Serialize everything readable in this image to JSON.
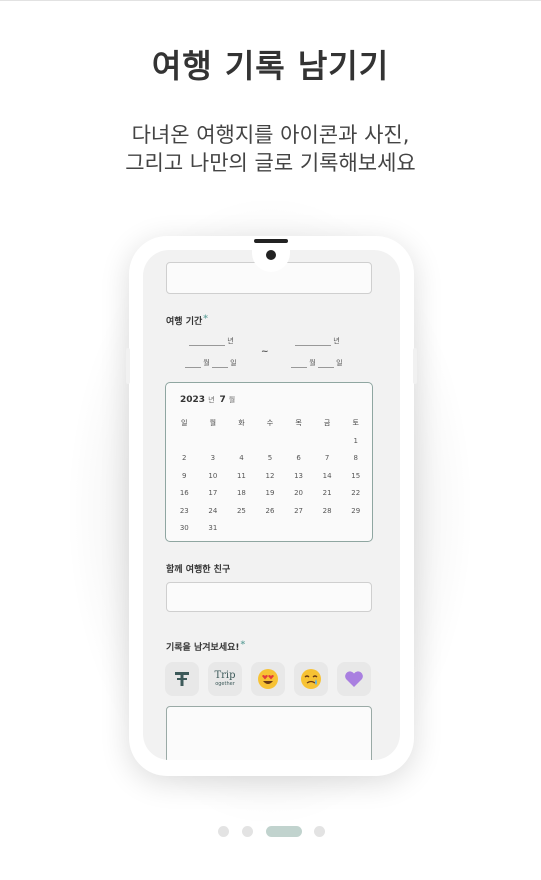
{
  "header": {
    "title": "여행 기록 남기기",
    "subtitle_line1": "다녀온 여행지를 아이콘과 사진,",
    "subtitle_line2": "그리고 나만의 글로 기록해보세요"
  },
  "form": {
    "period_label": "여행 기간",
    "required_mark": "*",
    "year_unit": "년",
    "month_unit": "월",
    "day_unit": "일",
    "range_separator": "~",
    "friends_label": "함께 여행한 친구",
    "record_label": "기록을 남겨보세요!"
  },
  "calendar": {
    "year": "2023",
    "year_unit": "년",
    "month": "7",
    "month_unit": "월",
    "weekdays": [
      "일",
      "월",
      "화",
      "수",
      "목",
      "금",
      "토"
    ],
    "days": [
      "",
      "",
      "",
      "",
      "",
      "",
      "1",
      "2",
      "3",
      "4",
      "5",
      "6",
      "7",
      "8",
      "9",
      "10",
      "11",
      "12",
      "13",
      "14",
      "15",
      "16",
      "17",
      "18",
      "19",
      "20",
      "21",
      "22",
      "23",
      "24",
      "25",
      "26",
      "27",
      "28",
      "29",
      "30",
      "31",
      "",
      "",
      "",
      "",
      ""
    ]
  },
  "icons": [
    {
      "name": "trip-logo-icon",
      "text": "T"
    },
    {
      "name": "trip-together-logo-icon",
      "text_top": "Trip",
      "text_bottom": "ogether"
    },
    {
      "name": "heart-eyes-emoji-icon",
      "text": "😍"
    },
    {
      "name": "crying-emoji-icon",
      "text": "🥲"
    },
    {
      "name": "purple-heart-icon",
      "text": "💜"
    }
  ],
  "pager": {
    "count": 4,
    "active_index": 2
  },
  "colors": {
    "accent": "#8fa6a1",
    "active_dot": "#c1d3ce",
    "required": "#6aa6a0"
  }
}
